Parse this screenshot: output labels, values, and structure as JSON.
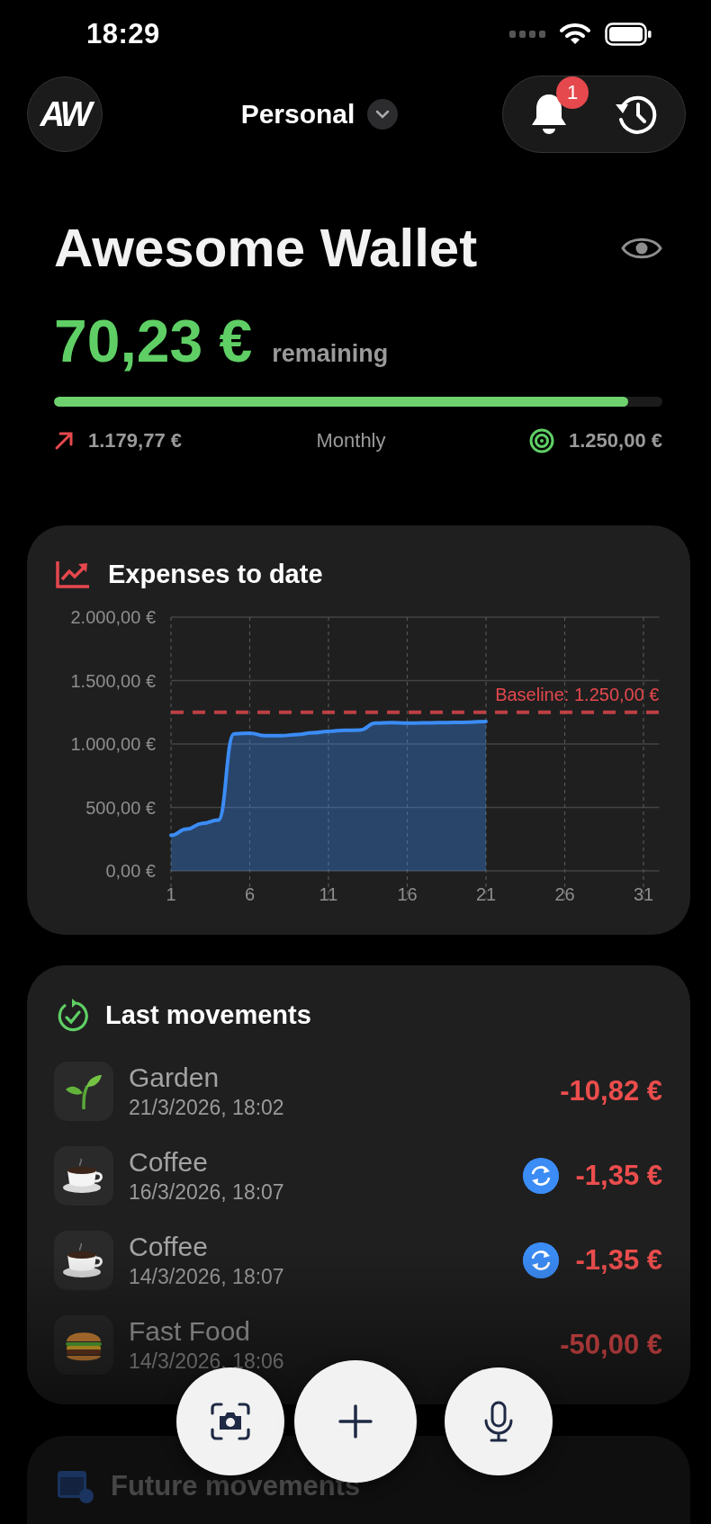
{
  "status_bar": {
    "time": "18:29"
  },
  "header": {
    "logo": "AW",
    "account": "Personal",
    "notification_badge": "1"
  },
  "wallet": {
    "title": "Awesome Wallet",
    "remaining_amount": "70,23 €",
    "remaining_label": "remaining",
    "budget": {
      "level": 0.944
    },
    "spent": "1.179,77 €",
    "period": "Monthly",
    "target": "1.250,00 €"
  },
  "expenses_card": {
    "chart_data": {
      "type": "area",
      "title": "Expenses to date",
      "x": [
        1,
        2,
        3,
        4,
        5,
        6,
        7,
        8,
        9,
        10,
        11,
        12,
        13,
        14,
        15,
        16,
        17,
        18,
        19,
        20,
        21
      ],
      "series": [
        {
          "color": "#3b8cf5",
          "values": [
            280,
            330,
            375,
            400,
            1080,
            1085,
            1065,
            1065,
            1075,
            1088,
            1100,
            1108,
            1110,
            1165,
            1168,
            1165,
            1166,
            1168,
            1170,
            1172,
            1178
          ]
        }
      ],
      "xlim": [
        1,
        32
      ],
      "ylim": [
        0,
        2000
      ],
      "grid": true,
      "xticks": [
        1,
        6,
        11,
        16,
        21,
        26,
        31
      ],
      "yticks": [
        {
          "value": 0,
          "label": "0,00 €"
        },
        {
          "value": 500,
          "label": "500,00 €"
        },
        {
          "value": 1000,
          "label": "1.000,00 €"
        },
        {
          "value": 1500,
          "label": "1.500,00 €"
        },
        {
          "value": 2000,
          "label": "2.000,00 €"
        }
      ],
      "ref_lines": [
        {
          "axis": "y",
          "value": 1250,
          "label": "Baseline: 1.250,00 €",
          "color": "#e5484d"
        }
      ]
    }
  },
  "last_movements": {
    "title": "Last movements",
    "items": [
      {
        "kind": "plant",
        "name": "Garden",
        "date": "21/3/2026, 18:02",
        "amount": "-10,82 €",
        "recurring": false
      },
      {
        "kind": "coffee",
        "name": "Coffee",
        "date": "16/3/2026, 18:07",
        "amount": "-1,35 €",
        "recurring": true
      },
      {
        "kind": "coffee",
        "name": "Coffee",
        "date": "14/3/2026, 18:07",
        "amount": "-1,35 €",
        "recurring": true
      },
      {
        "kind": "food",
        "name": "Fast Food",
        "date": "14/3/2026, 18:06",
        "amount": "-50,00 €",
        "recurring": false
      }
    ]
  },
  "actions": [
    {
      "kind": "camera"
    },
    {
      "kind": "add"
    },
    {
      "kind": "voice"
    }
  ],
  "future_movements": {
    "title": "Future movements"
  }
}
